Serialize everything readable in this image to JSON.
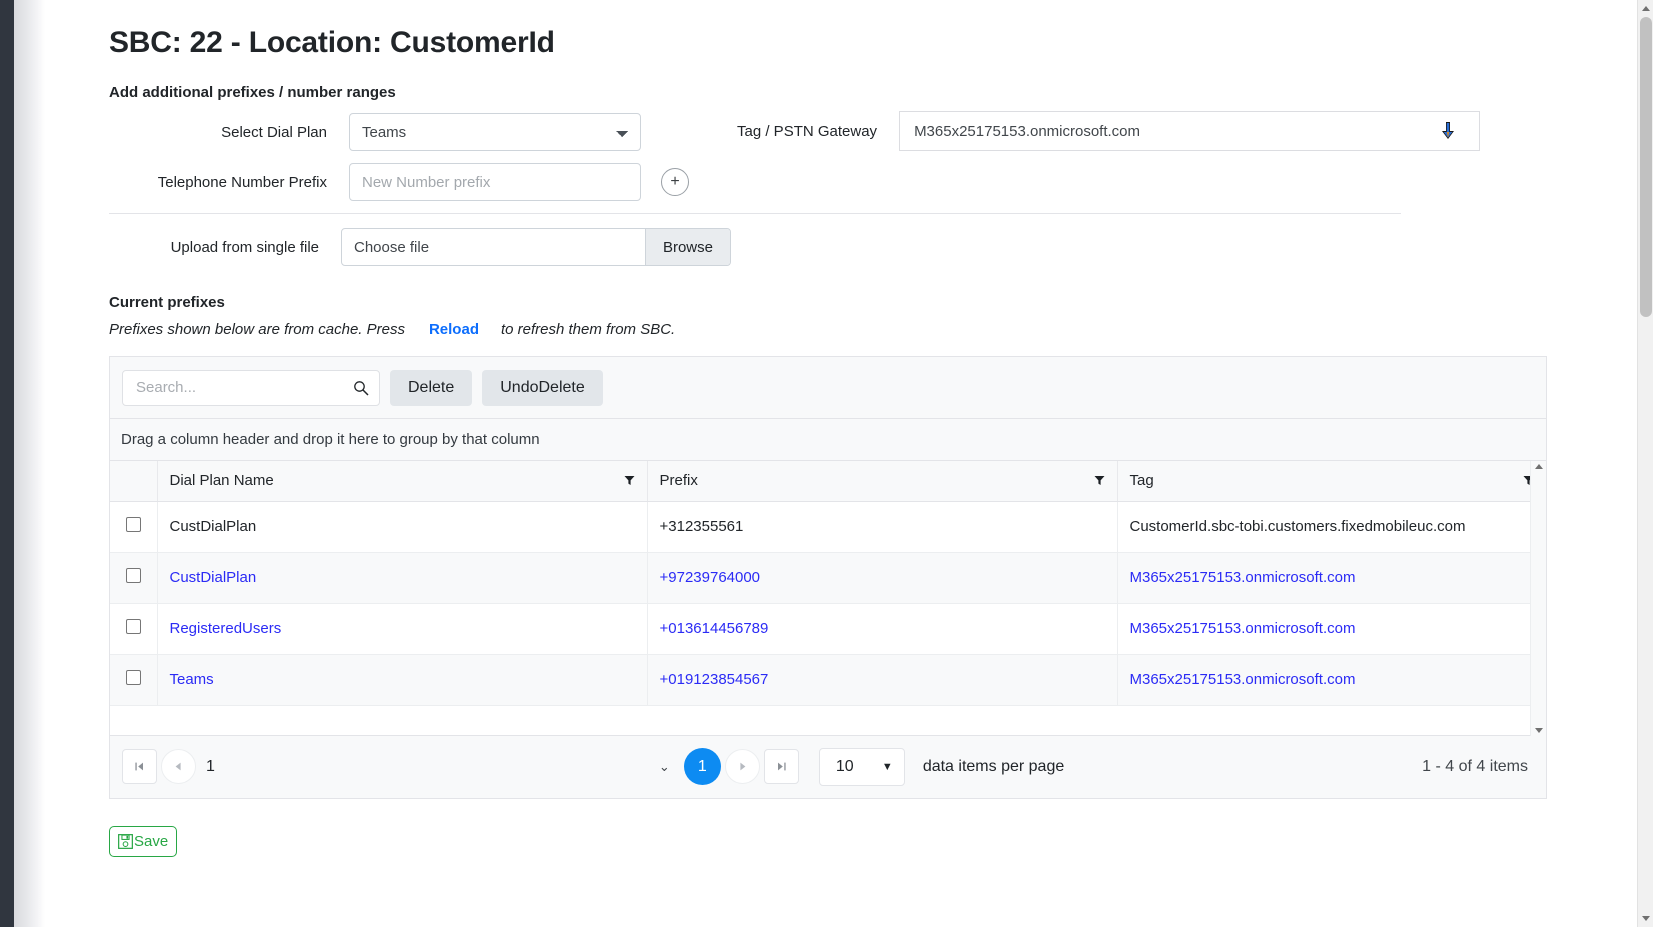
{
  "page": {
    "title": "SBC: 22 - Location: CustomerId",
    "add_section_label": "Add additional prefixes / number ranges",
    "current_prefixes_label": "Current prefixes"
  },
  "form": {
    "dial_plan_label": "Select Dial Plan",
    "dial_plan_value": "Teams",
    "dial_plan_options": [
      "Teams"
    ],
    "prefix_label": "Telephone Number Prefix",
    "prefix_placeholder": "New Number prefix",
    "prefix_value": "",
    "add_button_label": "+",
    "tag_label": "Tag / PSTN Gateway",
    "tag_value": "M365x25175153.onmicrosoft.com",
    "upload_label": "Upload from single file",
    "file_name": "Choose file",
    "browse_label": "Browse"
  },
  "cache_note": {
    "before": "Prefixes shown below are from cache. Press",
    "link": "Reload",
    "after": "to refresh them from SBC."
  },
  "toolbar": {
    "search_placeholder": "Search...",
    "search_value": "",
    "delete_label": "Delete",
    "undo_delete_label": "UndoDelete"
  },
  "grid": {
    "group_hint": "Drag a column header and drop it here to group by that column",
    "columns": [
      "Dial Plan Name",
      "Prefix",
      "Tag"
    ],
    "rows": [
      {
        "checked": false,
        "dial_plan_name": "CustDialPlan",
        "prefix": "+312355561",
        "tag": "CustomerId.sbc-tobi.customers.fixedmobileuc.com",
        "is_link": false
      },
      {
        "checked": false,
        "dial_plan_name": "CustDialPlan",
        "prefix": "+97239764000",
        "tag": "M365x25175153.onmicrosoft.com",
        "is_link": true
      },
      {
        "checked": false,
        "dial_plan_name": "RegisteredUsers",
        "prefix": "+013614456789",
        "tag": "M365x25175153.onmicrosoft.com",
        "is_link": true
      },
      {
        "checked": false,
        "dial_plan_name": "Teams",
        "prefix": "+019123854567",
        "tag": "M365x25175153.onmicrosoft.com",
        "is_link": true
      }
    ]
  },
  "pager": {
    "page_input_value": "1",
    "current_page": "1",
    "page_size": "10",
    "per_page_text": "data items per page",
    "items_summary": "1 - 4 of 4 items"
  },
  "footer": {
    "save_label": "Save"
  },
  "colors": {
    "link": "#2b2bf5",
    "reload_link": "#0d6efd",
    "pager_active": "#0d8bf2",
    "save_green": "#28a745"
  }
}
